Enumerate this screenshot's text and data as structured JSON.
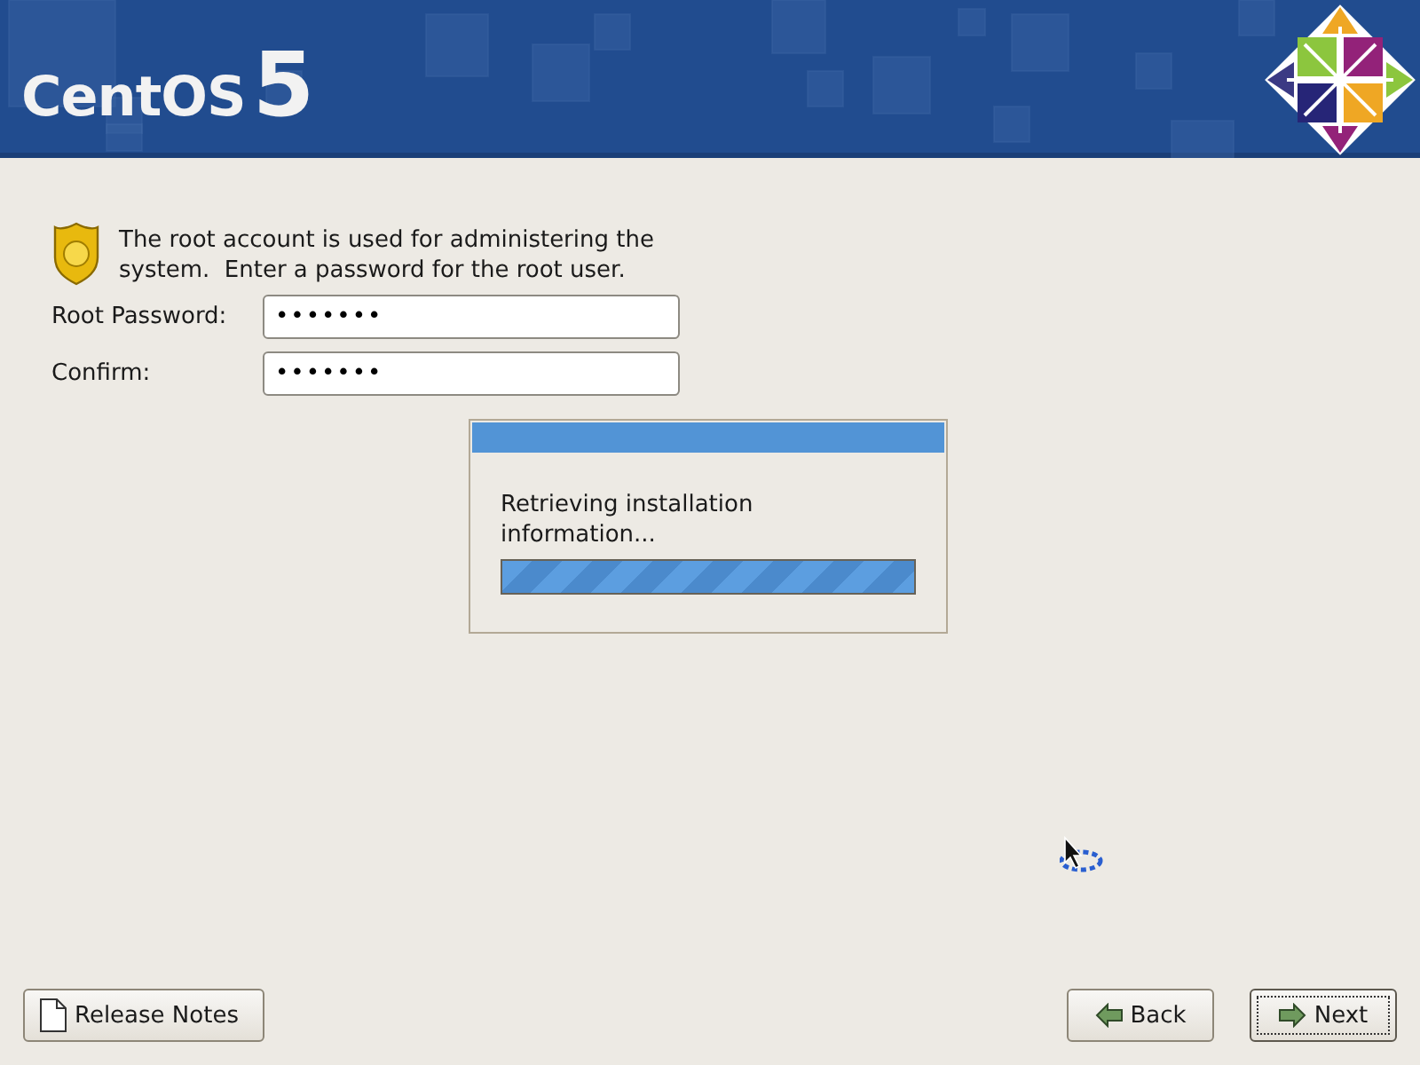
{
  "header": {
    "logo_name": "CentOS",
    "logo_version": "5"
  },
  "intro": "The root account is used for administering the system.  Enter a password for the root user.",
  "fields": [
    {
      "label": "Root Password:",
      "value": "•••••••"
    },
    {
      "label": "Confirm:",
      "value": "•••••••"
    }
  ],
  "progress_dialog": {
    "message": "Retrieving installation information...",
    "level": 1
  },
  "buttons": [
    {
      "kind": "notes",
      "label": "Release Notes",
      "focused": false
    },
    {
      "kind": "back",
      "label": "Back",
      "focused": false
    },
    {
      "kind": "next",
      "label": "Next",
      "focused": true
    }
  ]
}
